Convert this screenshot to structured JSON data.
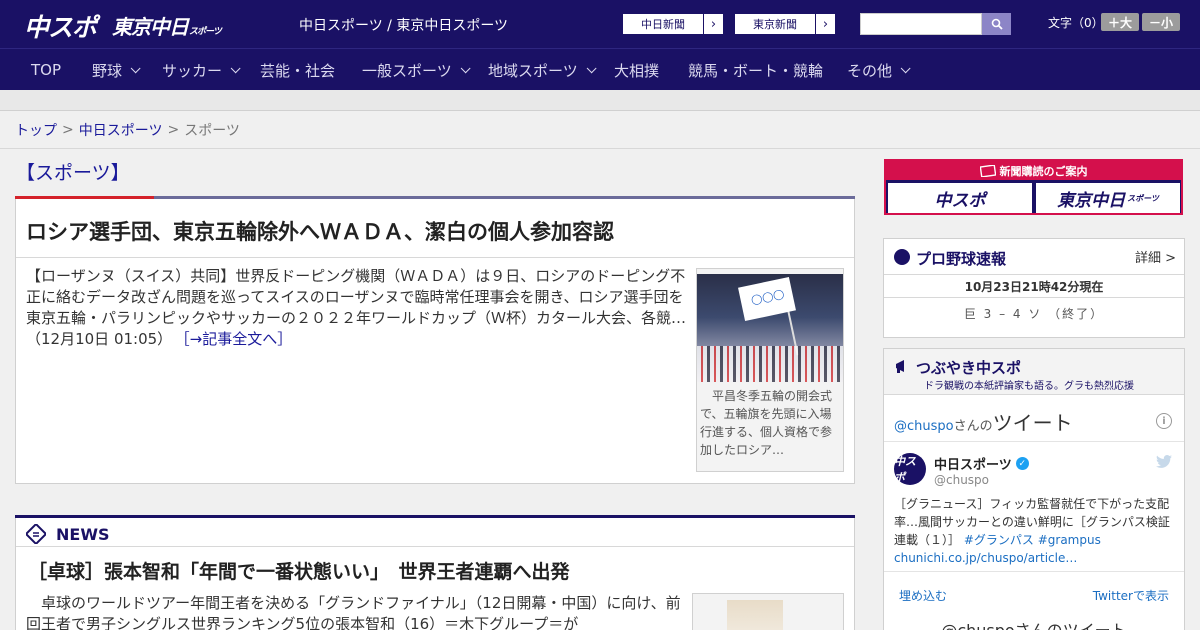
{
  "header": {
    "logo_chuspo": "中スポ",
    "logo_tokyo": "東京中日",
    "logo_tokyo_sub": "スポーツ",
    "site_title": "中日スポーツ / 東京中日スポーツ",
    "ext_links": [
      {
        "label": "中日新聞",
        "arrow": "›"
      },
      {
        "label": "東京新聞",
        "arrow": "›"
      }
    ],
    "search_placeholder": "",
    "font_label": "文字（0）",
    "font_large": "＋大",
    "font_small": "－小"
  },
  "nav": {
    "items": [
      {
        "label": "TOP",
        "dropdown": false
      },
      {
        "label": "野球",
        "dropdown": true
      },
      {
        "label": "サッカー",
        "dropdown": true
      },
      {
        "label": "芸能・社会",
        "dropdown": false
      },
      {
        "label": "一般スポーツ",
        "dropdown": true
      },
      {
        "label": "地域スポーツ",
        "dropdown": true
      },
      {
        "label": "大相撲",
        "dropdown": false
      },
      {
        "label": "競馬・ボート・競輪",
        "dropdown": false
      },
      {
        "label": "その他",
        "dropdown": true
      }
    ]
  },
  "breadcrumb": {
    "items": [
      "トップ",
      "中日スポーツ",
      "スポーツ"
    ],
    "separator": ">"
  },
  "section": {
    "title": "【スポーツ】"
  },
  "article": {
    "headline": "ロシア選手団、東京五輪除外へＷＡＤＡ、潔白の個人参加容認",
    "body": "【ローザンヌ（スイス）共同】世界反ドーピング機関（ＷＡＤＡ）は９日、ロシアのドーピング不正に絡むデータ改ざん問題を巡ってスイスのローザンヌで臨時常任理事会を開き、ロシア選手団を東京五輪・パラリンピックやサッカーの２０２２年ワールドカップ（Ｗ杯）カタール大会、各競…（12月10日 01:05）",
    "more_link": "［→記事全文へ］",
    "photo_caption": "平昌冬季五輪の開会式で、五輪旗を先頭に入場行進する、個人資格で参加したロシア…"
  },
  "news": {
    "label": "NEWS",
    "headline": "［卓球］張本智和「年間で一番状態いい」　世界王者連覇へ出発",
    "body": "卓球のワールドツアー年間王者を決める「グランドファイナル」（12日開幕・中国）に向け、前回王者で男子シングルス世界ランキング5位の張本智和（16）＝木下グループ＝が"
  },
  "promo": {
    "title": "新聞購読のご案内",
    "cell_chuspo": "中スポ",
    "cell_tokyo": "東京中日",
    "cell_tokyo_sub": "スポーツ"
  },
  "baseball": {
    "title": "プロ野球速報",
    "detail": "詳細 >",
    "timestamp": "10月23日21時42分現在",
    "score": "巨 3 – 4 ソ （終了）"
  },
  "tweets": {
    "title": "つぶやき中スポ",
    "subtitle": "ドラ観戦の本紙評論家も語る。グラも熱烈応援",
    "handle": "@chuspo",
    "handle_suffix": "さんの",
    "heading_big": "ツイート",
    "info": "i",
    "avatar_text": "中スポ",
    "name": "中日スポーツ",
    "username": "@chuspo",
    "text": "［グラニュース］フィッカ監督就任で下がった支配率…風間サッカーとの違い鮮明に［グランパス検証連載（１）］",
    "tags": "#グランパス #grampus",
    "link": "chunichi.co.jp/chuspo/article…",
    "embed": "埋め込む",
    "view_on_twitter": "Twitterで表示",
    "bottom": "@chuspoさんのツイート"
  }
}
